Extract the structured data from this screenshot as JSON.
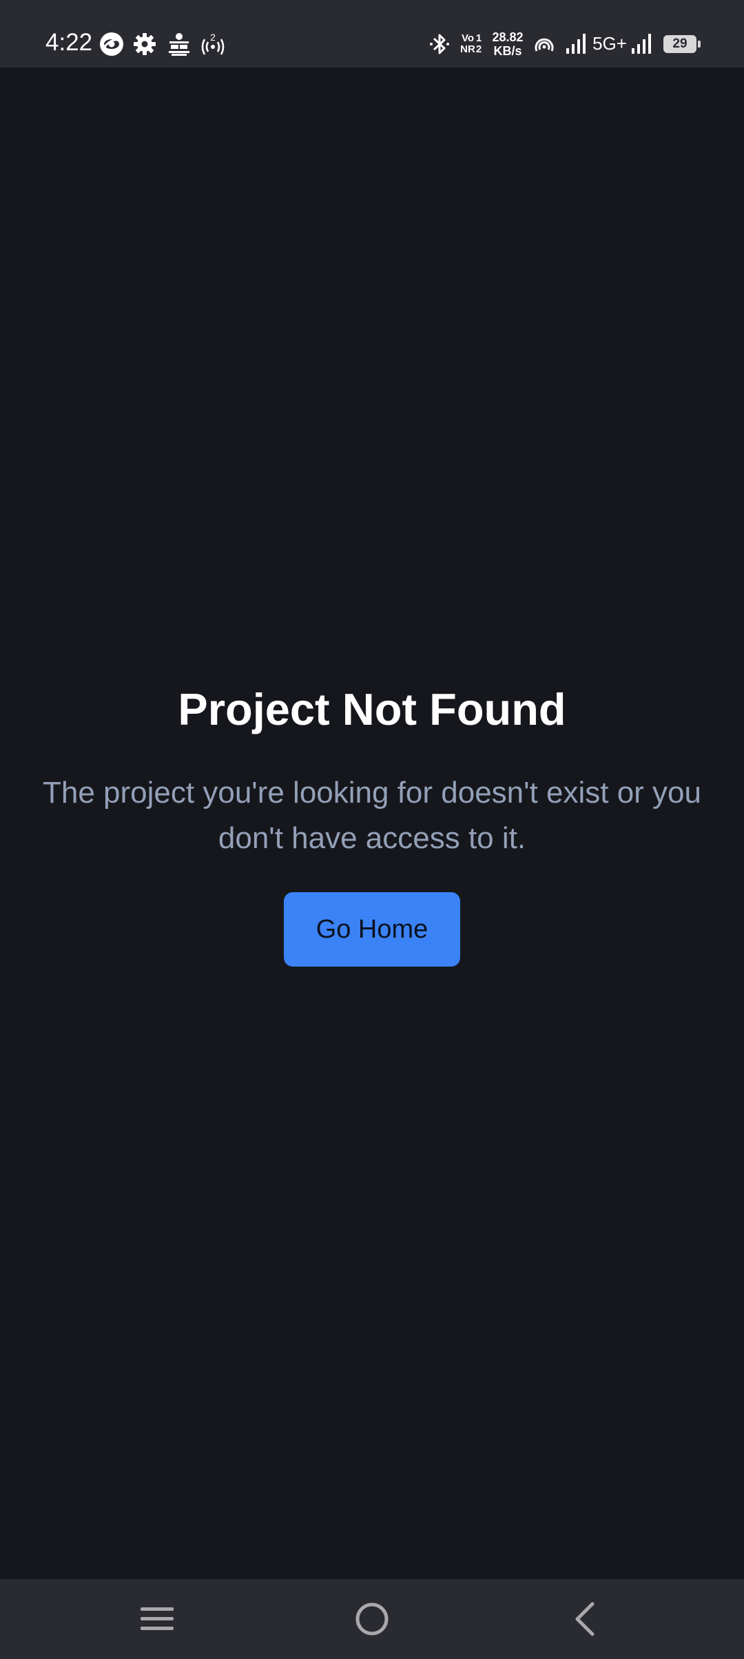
{
  "status_bar": {
    "time": "4:22",
    "left_icons": [
      "eye-circle-icon",
      "gear-icon",
      "news-app-icon",
      "hotspot-icon"
    ],
    "hotspot_count": "2",
    "right_icons": [
      "bluetooth-icon",
      "volte-icon",
      "data-speed",
      "wifi-calling-icon",
      "signal-icon",
      "5g-icon",
      "signal-icon",
      "battery-icon"
    ],
    "vo_label": "Vo",
    "vo_sub": "1",
    "nr_label": "NR",
    "nr_sub": "2",
    "speed_value": "28.82",
    "speed_unit": "KB/s",
    "network_type": "5G+",
    "battery_level": "29"
  },
  "main": {
    "title": "Project Not Found",
    "message": "The project you're looking for doesn't exist or you don't have access to it.",
    "button_label": "Go Home"
  },
  "nav_bar": {
    "buttons": [
      "menu-icon",
      "home-icon",
      "back-icon"
    ]
  },
  "colors": {
    "background": "#16171c",
    "bars": "#2a2a31",
    "accent": "#3b82f6",
    "message_text": "#93a0b8"
  }
}
